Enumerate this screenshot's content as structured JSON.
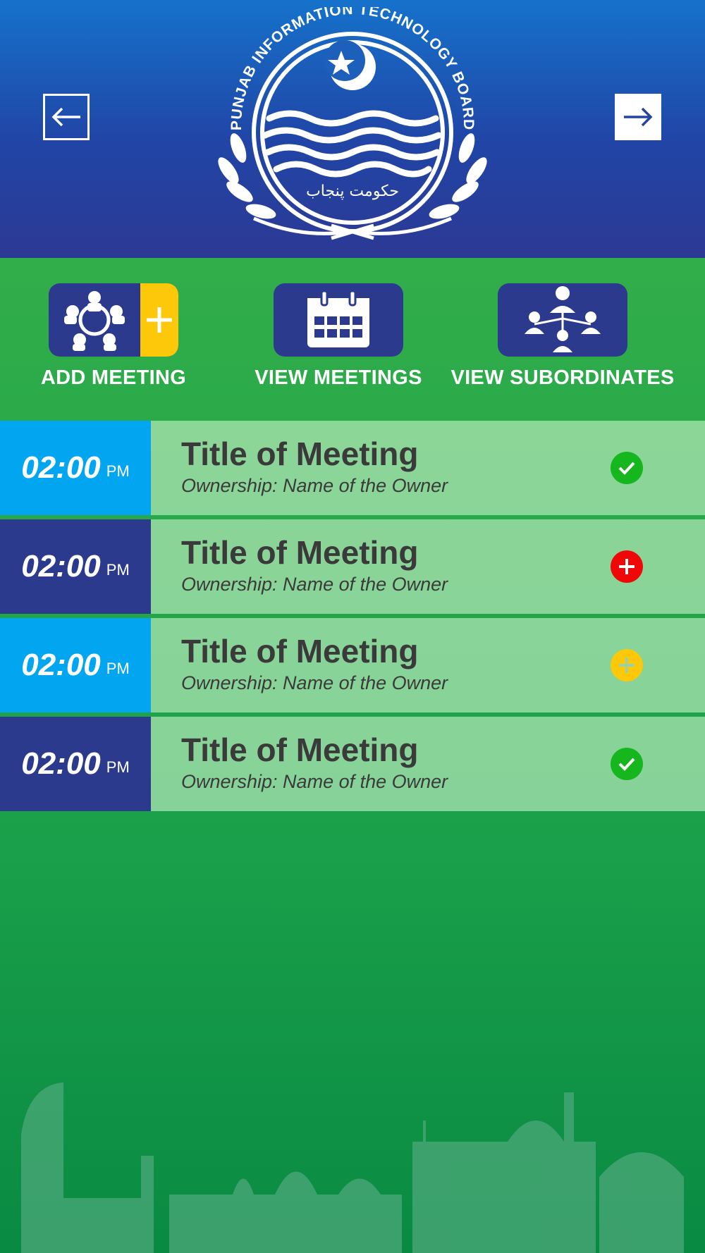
{
  "header": {
    "back_icon": "arrow-left-icon",
    "forward_icon": "arrow-right-icon",
    "logo": {
      "org_name": "PUNJAB INFORMATION TECHNOLOGY BOARD",
      "urdu_text": "حکومت پنجاب"
    }
  },
  "actions": [
    {
      "label": "ADD MEETING",
      "icon": "add-meeting-icon"
    },
    {
      "label": "VIEW MEETINGS",
      "icon": "calendar-icon"
    },
    {
      "label": "VIEW SUBORDINATES",
      "icon": "org-chart-icon"
    }
  ],
  "meetings": [
    {
      "time": "02:00",
      "ampm": "PM",
      "title": "Title of Meeting",
      "owner": "Ownership: Name of the Owner",
      "status": "check",
      "status_color": "#15b61e",
      "time_bg": "#02a6f0"
    },
    {
      "time": "02:00",
      "ampm": "PM",
      "title": "Title of Meeting",
      "owner": "Ownership: Name of the Owner",
      "status": "plus",
      "status_color": "#f00808",
      "time_bg": "#2c3a8e"
    },
    {
      "time": "02:00",
      "ampm": "PM",
      "title": "Title of Meeting",
      "owner": "Ownership: Name of the Owner",
      "status": "plus",
      "status_color": "#fdc70a",
      "time_bg": "#02a6f0"
    },
    {
      "time": "02:00",
      "ampm": "PM",
      "title": "Title of Meeting",
      "owner": "Ownership: Name of the Owner",
      "status": "check",
      "status_color": "#15b61e",
      "time_bg": "#2c3a8e"
    }
  ],
  "colors": {
    "header_top": "#1572cb",
    "header_bottom": "#2c3994",
    "green": "#3cb44a",
    "navy": "#2c3a8e",
    "yellow": "#fdc70a",
    "light_blue": "#02a6f0"
  }
}
